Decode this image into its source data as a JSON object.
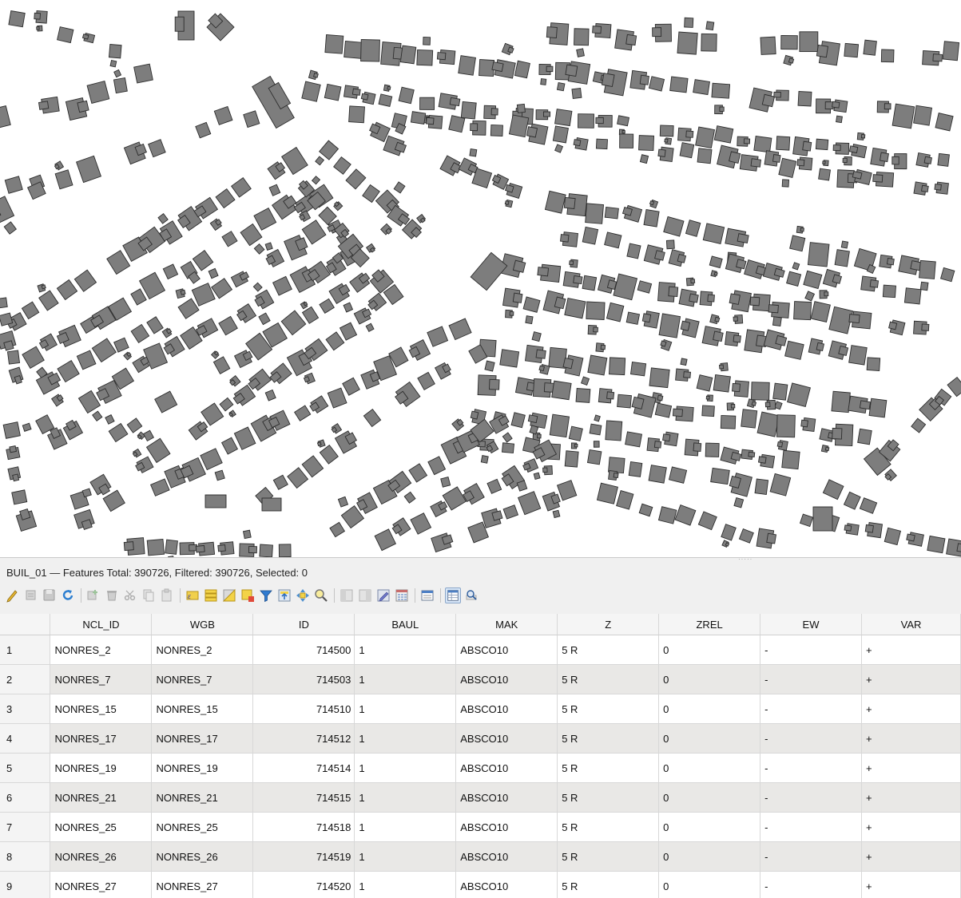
{
  "map": {
    "building_fill": "#7d7d7d",
    "building_stroke": "#2d2d2d",
    "background": "#ffffff"
  },
  "attribute_table": {
    "title": "BUIL_01 — Features Total: 390726, Filtered: 390726, Selected: 0",
    "toolbar": [
      {
        "icon": "pencil-toggle-editing-icon"
      },
      {
        "icon": "multi-edit-icon"
      },
      {
        "icon": "save-edits-icon"
      },
      {
        "icon": "reload-icon"
      },
      {
        "sep": true
      },
      {
        "icon": "add-feature-icon"
      },
      {
        "icon": "delete-selected-icon"
      },
      {
        "icon": "cut-icon"
      },
      {
        "icon": "copy-icon"
      },
      {
        "icon": "paste-icon"
      },
      {
        "sep": true
      },
      {
        "icon": "select-by-expression-icon"
      },
      {
        "icon": "select-all-icon"
      },
      {
        "icon": "invert-selection-icon"
      },
      {
        "icon": "deselect-all-icon"
      },
      {
        "icon": "filter-select-icon"
      },
      {
        "icon": "move-selection-top-icon"
      },
      {
        "icon": "pan-to-selection-icon"
      },
      {
        "icon": "zoom-to-selection-icon"
      },
      {
        "sep": true
      },
      {
        "icon": "new-field-icon"
      },
      {
        "icon": "delete-field-icon"
      },
      {
        "icon": "field-calculator-edit-icon"
      },
      {
        "icon": "conditional-formatting-icon"
      },
      {
        "sep": true
      },
      {
        "icon": "dock-table-icon"
      },
      {
        "sep": true
      },
      {
        "icon": "table-view-icon",
        "active": true
      },
      {
        "icon": "form-view-icon"
      }
    ],
    "columns": [
      "NCL_ID",
      "WGB",
      "ID",
      "BAUL",
      "MAK",
      "Z",
      "ZREL",
      "EW",
      "VAR"
    ],
    "rows": [
      [
        "1",
        "NONRES_2",
        "NONRES_2",
        "714500",
        "1",
        "ABSCO10",
        "5 R",
        "0",
        "-",
        "+"
      ],
      [
        "2",
        "NONRES_7",
        "NONRES_7",
        "714503",
        "1",
        "ABSCO10",
        "5 R",
        "0",
        "-",
        "+"
      ],
      [
        "3",
        "NONRES_15",
        "NONRES_15",
        "714510",
        "1",
        "ABSCO10",
        "5 R",
        "0",
        "-",
        "+"
      ],
      [
        "4",
        "NONRES_17",
        "NONRES_17",
        "714512",
        "1",
        "ABSCO10",
        "5 R",
        "0",
        "-",
        "+"
      ],
      [
        "5",
        "NONRES_19",
        "NONRES_19",
        "714514",
        "1",
        "ABSCO10",
        "5 R",
        "0",
        "-",
        "+"
      ],
      [
        "6",
        "NONRES_21",
        "NONRES_21",
        "714515",
        "1",
        "ABSCO10",
        "5 R",
        "0",
        "-",
        "+"
      ],
      [
        "7",
        "NONRES_25",
        "NONRES_25",
        "714518",
        "1",
        "ABSCO10",
        "5 R",
        "0",
        "-",
        "+"
      ],
      [
        "8",
        "NONRES_26",
        "NONRES_26",
        "714519",
        "1",
        "ABSCO10",
        "5 R",
        "0",
        "-",
        "+"
      ],
      [
        "9",
        "NONRES_27",
        "NONRES_27",
        "714520",
        "1",
        "ABSCO10",
        "5 R",
        "0",
        "-",
        "+"
      ]
    ]
  }
}
